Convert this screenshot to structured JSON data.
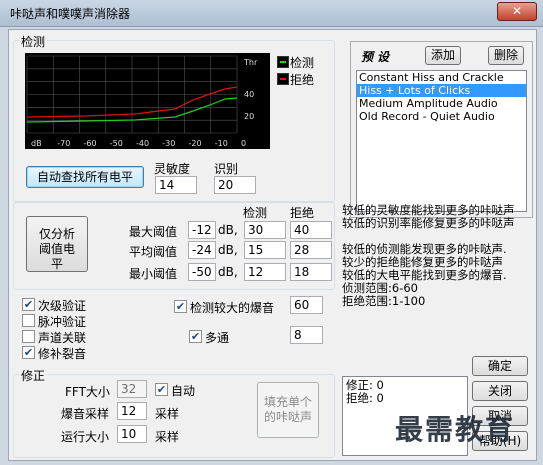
{
  "window": {
    "title": "咔哒声和噗噗声消除器",
    "close": "✕"
  },
  "detection": {
    "group_label": "检测",
    "graph": {
      "thr_label": "Thr",
      "x_labels": [
        "dB",
        "-70",
        "-60",
        "-50",
        "-40",
        "-30",
        "-20",
        "-10",
        "0"
      ],
      "y_labels": [
        "40",
        "20"
      ],
      "legend": [
        {
          "label": "检测",
          "color": "#22cc22"
        },
        {
          "label": "拒绝",
          "color": "#e01010"
        }
      ]
    },
    "find_all_button": "自动查找所有电平",
    "sensitivity_label": "灵敏度",
    "sensitivity_value": "14",
    "discrimination_label": "识别",
    "discrimination_value": "20",
    "analyze_button": "仅分析阈值电平",
    "col_detect": "检测",
    "col_reject": "拒绝",
    "rows": [
      {
        "label": "最大阈值",
        "db": "-12",
        "unit": "dB,",
        "detect": "30",
        "reject": "40"
      },
      {
        "label": "平均阈值",
        "db": "-24",
        "unit": "dB,",
        "detect": "15",
        "reject": "28"
      },
      {
        "label": "最小阈值",
        "db": "-50",
        "unit": "dB,",
        "detect": "12",
        "reject": "18"
      }
    ]
  },
  "options": {
    "second_level": "次级验证",
    "pulse_train": "脉冲验证",
    "link_channels": "声道关联",
    "repair_crackle": "修补裂音",
    "detect_big_pops": "检测较大的爆音",
    "big_pops_value": "60",
    "multi_pass": "多通",
    "multi_pass_value": "8"
  },
  "correction": {
    "group_label": "修正",
    "fft_label": "FFT大小",
    "fft_value": "32",
    "auto_label": "自动",
    "pop_label": "爆音采样",
    "pop_value": "12",
    "pop_unit": "采样",
    "run_label": "运行大小",
    "run_value": "10",
    "run_unit": "采样",
    "fill_button": "填充单个的咔哒声"
  },
  "presets": {
    "title": "预设",
    "add_button": "添加",
    "delete_button": "删除",
    "items": [
      "Constant Hiss and Crackle",
      "Hiss + Lots of Clicks",
      "Medium Amplitude Audio",
      "Old Record - Quiet Audio"
    ],
    "selected": 1
  },
  "help_text": {
    "line1": "较低的灵敏度能找到更多的咔哒声",
    "line2": "较低的识别率能修复更多的咔哒声",
    "line3": "较低的侦测能发现更多的咔哒声.",
    "line4": "较少的拒绝能修复更多的咔哒声",
    "line5": "较低的大电平能找到更多的爆音.",
    "line6": "侦测范围:6-60",
    "line7": "拒绝范围:1-100"
  },
  "status": {
    "fixed": "修正: 0",
    "rejected": "拒绝: 0"
  },
  "buttons": {
    "ok": "确定",
    "close": "关闭",
    "cancel": "取消",
    "help": "帮助(H)"
  },
  "watermark": "最需教育"
}
